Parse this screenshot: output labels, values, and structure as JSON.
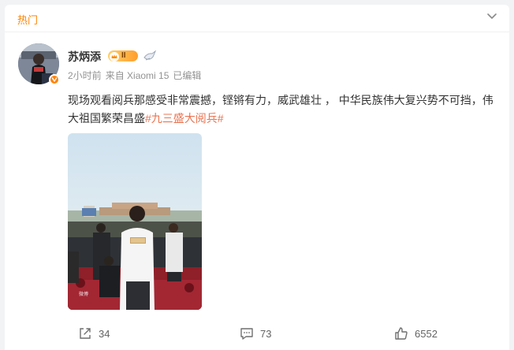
{
  "header": {
    "section_label": "热门"
  },
  "post": {
    "author": "苏炳添",
    "vip_level": "II",
    "time": "2小时前",
    "source": "来自 Xiaomi 15",
    "edited": "已编辑",
    "text": "现场观看阅兵那感受非常震撼，铿锵有力，威武雄壮 ， 中华民族伟大复兴势不可挡，伟大祖国繁荣昌盛",
    "topic": "#九三盛大阅兵#",
    "image_watermark": "微博"
  },
  "actions": {
    "repost_count": "34",
    "comment_count": "73",
    "like_count": "6552"
  },
  "colors": {
    "accent": "#ff8200",
    "topic": "#eb7350",
    "text": "#333333",
    "meta": "#939393",
    "background": "#f2f3f5"
  },
  "icons": [
    "chevron-down-icon",
    "verified-badge-icon",
    "vip-crown-icon",
    "bird-badge-icon",
    "repost-icon",
    "comment-icon",
    "like-icon"
  ]
}
